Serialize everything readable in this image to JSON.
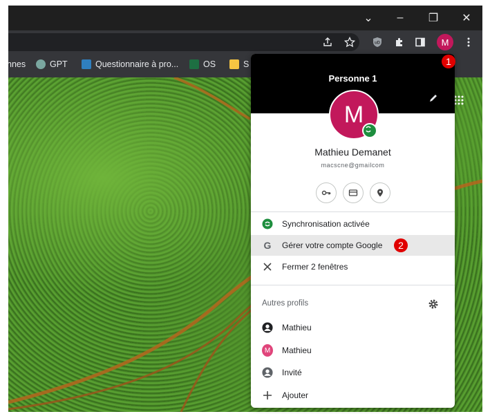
{
  "window": {
    "controls": {
      "menu": "⌄",
      "minimize": "–",
      "restore": "❐",
      "close": "✕"
    }
  },
  "toolbar": {
    "profile_initial": "M"
  },
  "bookmarks": [
    {
      "label": "nnes",
      "color": ""
    },
    {
      "label": "GPT",
      "color": "#7aa7a0"
    },
    {
      "label": "Questionnaire à pro...",
      "color": "#2f7fbf"
    },
    {
      "label": "OS",
      "color": "#1d6f42"
    },
    {
      "label": "S",
      "color": "#f5c542"
    }
  ],
  "annotations": {
    "step1": "1",
    "step2": "2"
  },
  "profile_menu": {
    "title": "Personne 1",
    "avatar_initial": "M",
    "name": "Mathieu Demanet",
    "email_obfuscated": "macscne@gmailcom",
    "rows": {
      "sync": "Synchronisation activée",
      "manage_google": "Gérer votre compte Google",
      "close_windows": "Fermer 2 fenêtres"
    },
    "other_profiles_header": "Autres profils",
    "profiles": [
      {
        "label": "Mathieu",
        "kind": "account",
        "color": "#202124"
      },
      {
        "label": "Mathieu",
        "kind": "initial",
        "initial": "M",
        "color": "#e0457b"
      },
      {
        "label": "Invité",
        "kind": "guest",
        "color": "#5f6368"
      }
    ],
    "add_label": "Ajouter"
  },
  "colors": {
    "avatar": "#c2185b",
    "sync_green": "#1e8e3e",
    "badge_red": "#e00000",
    "toolbar": "#35363a"
  }
}
